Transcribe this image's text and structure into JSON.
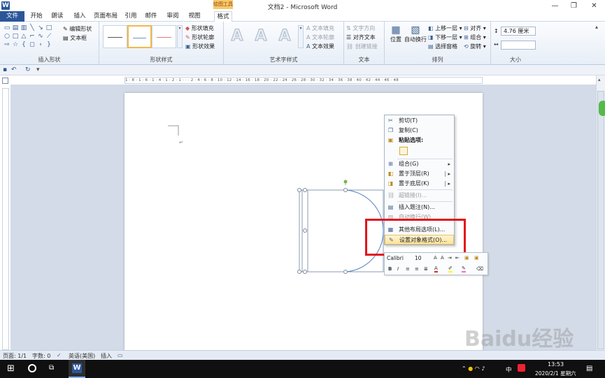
{
  "titlebar": {
    "app_icon": "W",
    "title": "文档2 - Microsoft Word",
    "qat_icons": [
      "save-icon",
      "undo-icon",
      "redo-icon"
    ],
    "controls": [
      "minimize",
      "maximize",
      "close"
    ]
  },
  "tabs": {
    "file": "文件",
    "items": [
      "开始",
      "朗读",
      "插入",
      "页面布局",
      "引用",
      "邮件",
      "审阅",
      "视图"
    ],
    "context_header": "绘图工具",
    "context_tab": "格式"
  },
  "ribbon": {
    "groups": {
      "insert_shapes": "插入形状",
      "shape_styles": "形状样式",
      "wordart_styles": "艺术字样式",
      "text": "文本",
      "arrange": "排列",
      "size": "大小"
    },
    "insert_shapes_buttons": [
      "编辑形状",
      "文本框"
    ],
    "shape_style_buttons": [
      "形状填充",
      "形状轮廓",
      "形状效果"
    ],
    "wordart_letter": "A",
    "wordart_buttons": [
      "文本填充",
      "文本轮廓",
      "文本效果"
    ],
    "text_buttons": [
      "文字方向",
      "对齐文本",
      "创建链接"
    ],
    "arrange_big": [
      "位置",
      "自动换行"
    ],
    "arrange_buttons": [
      "上移一层",
      "下移一层",
      "选择窗格",
      "对齐",
      "组合",
      "旋转"
    ],
    "size": {
      "height_value": "4.76 厘米",
      "width_value": ""
    },
    "style_line_colors": [
      "#555555",
      "#6f95c9",
      "#e07a7a"
    ]
  },
  "ruler": {
    "h_numbers": "1 · 8 · 1 · 6 · 1 · 4 · 1 · 2 · 1 · · · 2 · 4 · 6 · 8 · 10 · 12 · 14 · 16 · 18 · 20 · 22 · 24 · 26 · 28 · 30 · 32 · 34 · 36 · 38 · 40 · 42 · 44 · 46 · 48"
  },
  "context_menu": {
    "items": [
      {
        "label": "剪切(T)",
        "icon": "scissors-icon",
        "disabled": false
      },
      {
        "label": "复制(C)",
        "icon": "copy-icon",
        "disabled": false
      },
      {
        "label": "粘贴选项:",
        "icon": "paste-icon",
        "disabled": false,
        "bold": true
      },
      {
        "label": "组合(G)",
        "icon": "group-icon",
        "disabled": false,
        "submenu": true
      },
      {
        "label": "置于顶层(R)",
        "icon": "bring-front-icon",
        "disabled": false,
        "submenu": true
      },
      {
        "label": "置于底层(K)",
        "icon": "send-back-icon",
        "disabled": false,
        "submenu": true
      },
      {
        "label": "超链接(I)...",
        "icon": "hyperlink-icon",
        "disabled": true
      },
      {
        "label": "插入题注(N)...",
        "icon": "caption-icon",
        "disabled": false
      },
      {
        "label": "自动换行(W)",
        "icon": "wrap-icon",
        "disabled": false,
        "submenu": true
      },
      {
        "label": "其他布局选项(L)...",
        "icon": "layout-icon",
        "disabled": false
      },
      {
        "label": "设置对象格式(O)...",
        "icon": "format-object-icon",
        "disabled": false,
        "highlighted": true
      }
    ]
  },
  "mini_toolbar": {
    "font": "Calibri",
    "size": "10",
    "row1_icons": [
      "grow-font-icon",
      "shrink-font-icon",
      "indent-icon",
      "outdent-icon",
      "format-painter-icon",
      "styles-icon"
    ],
    "row2_icons": [
      "bold-icon",
      "italic-icon",
      "align-center-icon",
      "align-left-icon",
      "align-justify-icon",
      "font-color-icon",
      "highlight-icon",
      "line-color-icon",
      "eraser-icon"
    ]
  },
  "statusbar": {
    "page": "页面: 1/1",
    "words": "字数: 0",
    "language": "英语(美国)",
    "mode": "插入"
  },
  "taskbar": {
    "time": "13:53",
    "date": "2020/2/1 星期六",
    "ime": "中",
    "tray_icons": [
      "chevron-up-icon",
      "shield-icon",
      "wifi-icon",
      "volume-icon",
      "ime-icon",
      "antivirus-icon"
    ]
  },
  "watermark": {
    "text": "Baidu经验",
    "url": "jingyan.baidu.com"
  },
  "colors": {
    "accent": "#2b579a",
    "highlight_box": "#e2141b",
    "menu_hover": "#ffe39a"
  }
}
